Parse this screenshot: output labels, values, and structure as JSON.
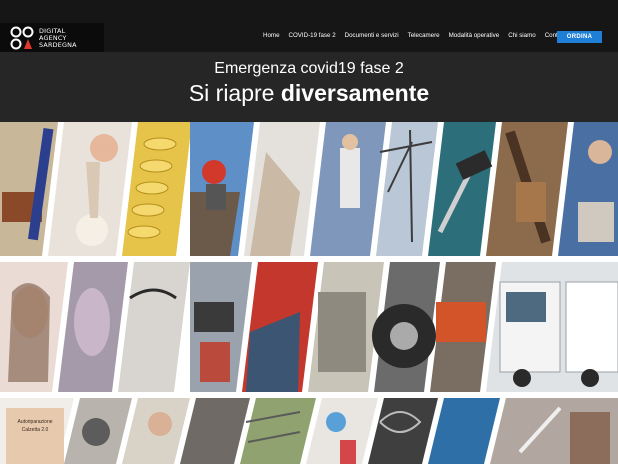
{
  "brand": {
    "line1": "DIGITAL",
    "line2": "AGENCY",
    "line3": "SARDEGNA",
    "accent": "#e2372b"
  },
  "nav": {
    "items": [
      "Home",
      "COVID-19 fase 2",
      "Documenti e servizi",
      "Telecamere",
      "Modalità operative",
      "Chi siamo",
      "Contatti"
    ],
    "cta_label": "ORDINA",
    "cta_color": "#1f7fd6"
  },
  "hero": {
    "subtitle": "Emergenza covid19 fase 2",
    "title_normal": "Si riapre",
    "title_bold": "diversamente"
  },
  "mosaic": {
    "badge_line1": "Autoriparazione",
    "badge_line2": "Calzetta 2.0"
  }
}
